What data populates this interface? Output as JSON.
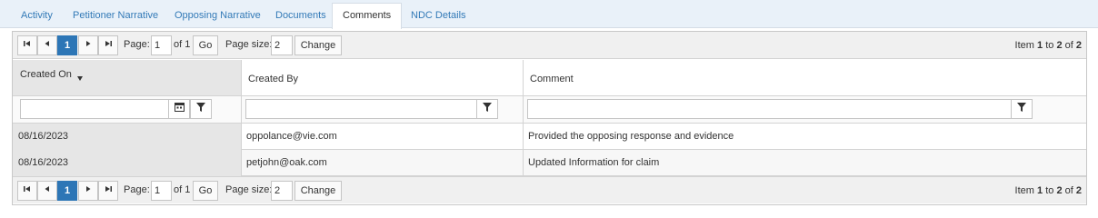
{
  "tabs": [
    {
      "label": "Activity",
      "active": false
    },
    {
      "label": "Petitioner Narrative",
      "active": false
    },
    {
      "label": "Opposing Narrative",
      "active": false
    },
    {
      "label": "Documents",
      "active": false
    },
    {
      "label": "Comments",
      "active": true
    },
    {
      "label": "NDC Details",
      "active": false
    }
  ],
  "pager": {
    "first_glyph": "⏮",
    "prev_glyph": "◀",
    "current_page": "1",
    "next_glyph": "▶",
    "last_glyph": "⏭",
    "page_label": "Page:",
    "page_value": "1",
    "of_label": "of 1",
    "go_label": "Go",
    "size_label": "Page size:",
    "size_value": "2",
    "change_label": "Change",
    "items_prefix": "Item",
    "items_from": "1",
    "items_to_label": "to",
    "items_to": "2",
    "items_of_label": "of",
    "items_total": "2"
  },
  "columns": [
    {
      "label": "Created On",
      "sorted": "desc"
    },
    {
      "label": "Created By"
    },
    {
      "label": "Comment"
    }
  ],
  "rows": [
    {
      "created_on": "08/16/2023",
      "created_by": "oppolance@vie.com",
      "comment": "Provided the opposing response and evidence"
    },
    {
      "created_on": "08/16/2023",
      "created_by": "petjohn@oak.com",
      "comment": "Updated Information for claim"
    }
  ],
  "icons": {
    "calendar": "calendar-icon",
    "filter": "filter-icon",
    "sort": "sort-desc-icon"
  },
  "colors": {
    "accent": "#2d76b6",
    "link": "#337ab7",
    "tab_bg": "#e9f1f9"
  }
}
